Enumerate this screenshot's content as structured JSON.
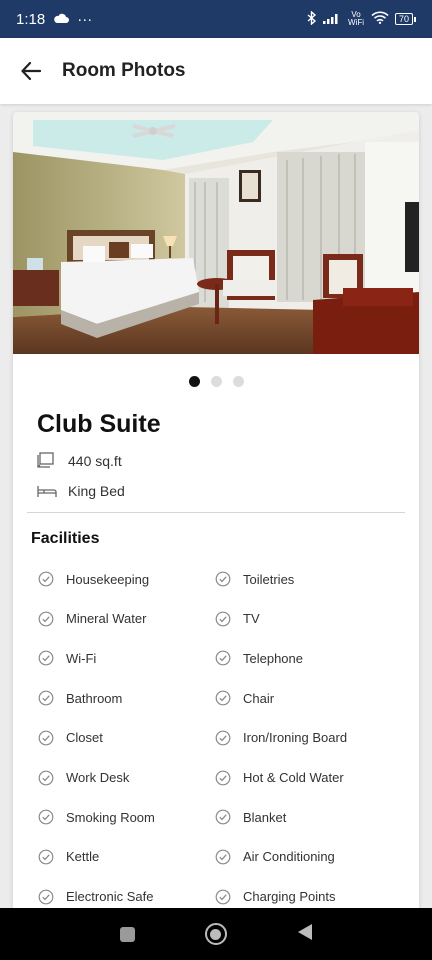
{
  "status": {
    "time": "1:18",
    "more": "···",
    "volte": "Vo WiFi",
    "battery": "70"
  },
  "header": {
    "title": "Room Photos"
  },
  "carousel": {
    "slides": 3,
    "active": 0
  },
  "room": {
    "name": "Club Suite",
    "size": "440 sq.ft",
    "bed": "King Bed"
  },
  "facilities": {
    "title": "Facilities",
    "left": [
      "Housekeeping",
      "Mineral Water",
      "Wi-Fi",
      "Bathroom",
      "Closet",
      "Work Desk",
      "Smoking Room",
      "Kettle",
      "Electronic Safe"
    ],
    "right": [
      "Toiletries",
      "TV",
      "Telephone",
      "Chair",
      "Iron/Ironing Board",
      "Hot & Cold Water",
      "Blanket",
      "Air Conditioning",
      "Charging Points"
    ]
  },
  "colors": {
    "status_bar": "#1f3a66",
    "check": "#8a8a8a"
  }
}
